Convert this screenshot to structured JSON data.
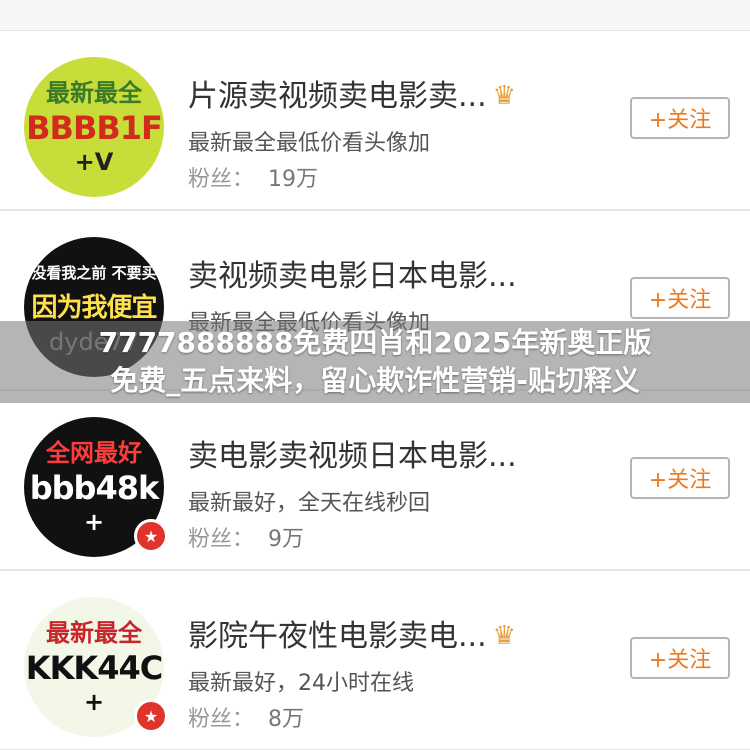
{
  "accounts": [
    {
      "avatar": {
        "top": "最新最全",
        "main": "BBBB1F",
        "bottom": "+V"
      },
      "name": "片源卖视频卖电影卖...",
      "crown": true,
      "badge": false,
      "desc": "最新最全最低价看头像加",
      "fans_label": "粉丝：",
      "fans_value": "19万",
      "follow_label": "+关注"
    },
    {
      "avatar": {
        "top": "没看我之前 不要买",
        "main": "因为我便宜",
        "bottom": "dyde77"
      },
      "name": "卖视频卖电影日本电影...",
      "crown": false,
      "badge": false,
      "desc": "最新最全最低价看头像加",
      "follow_label": "+关注"
    },
    {
      "avatar": {
        "top": "全网最好",
        "main": "bbb48k",
        "bottom": "+"
      },
      "name": "卖电影卖视频日本电影...",
      "crown": false,
      "badge": true,
      "desc": "最新最好，全天在线秒回",
      "fans_label": "粉丝：",
      "fans_value": "9万",
      "follow_label": "+关注"
    },
    {
      "avatar": {
        "top": "最新最全",
        "main": "KKK44C",
        "bottom": "+"
      },
      "name": "影院午夜性电影卖电...",
      "crown": true,
      "badge": true,
      "desc": "最新最好，24小时在线",
      "fans_label": "粉丝：",
      "fans_value": "8万",
      "follow_label": "+关注"
    }
  ],
  "banner": {
    "line1": "7777888888免费四肖和2025年新奥正版",
    "line2": "免费_五点来料，留心欺诈性营销-贴切释义"
  },
  "colors": {
    "follow_text": "#ee7a1f",
    "name_text": "#333333",
    "crown": "#e8a03a",
    "vbadge": "#e0332c"
  }
}
